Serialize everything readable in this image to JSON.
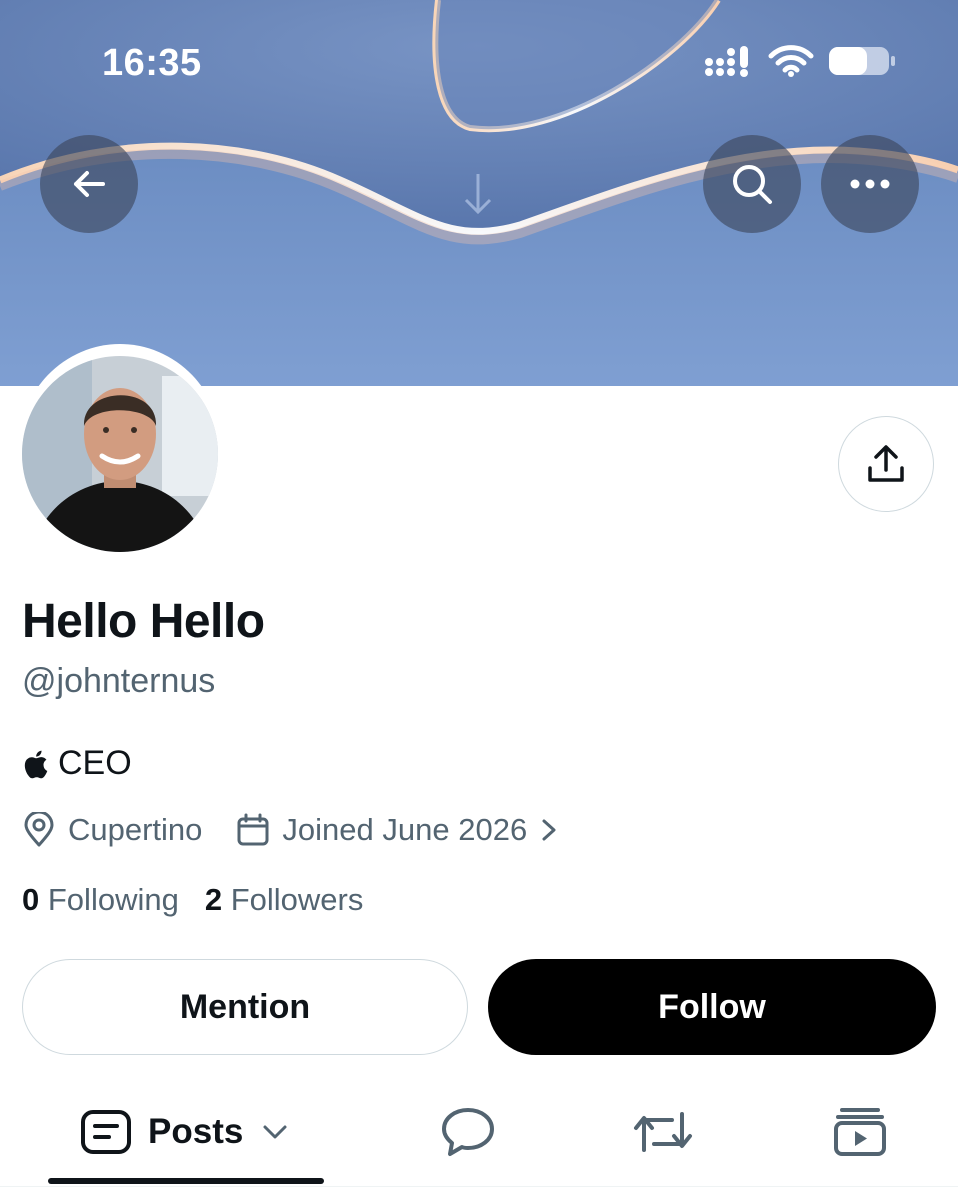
{
  "status_bar": {
    "time": "16:35"
  },
  "profile": {
    "name": "Hello Hello",
    "handle": "@johnternus",
    "bio": "CEO",
    "location": "Cupertino",
    "joined": "Joined June 2026",
    "following_count": "0",
    "following_label": "Following",
    "followers_count": "2",
    "followers_label": "Followers"
  },
  "actions": {
    "mention_label": "Mention",
    "follow_label": "Follow"
  },
  "tabs": [
    {
      "label": "Posts",
      "active": true
    }
  ],
  "icons": [
    "back-arrow-icon",
    "search-icon",
    "more-icon",
    "share-icon",
    "apple-logo-icon",
    "location-pin-icon",
    "calendar-icon",
    "chevron-right-icon",
    "posts-icon",
    "chevron-down-icon",
    "replies-icon",
    "reposts-icon",
    "media-icon"
  ],
  "colors": {
    "banner": "#6e8fc4",
    "follow_button": "#000000",
    "secondary_text": "#536471",
    "text": "#0f1419"
  }
}
